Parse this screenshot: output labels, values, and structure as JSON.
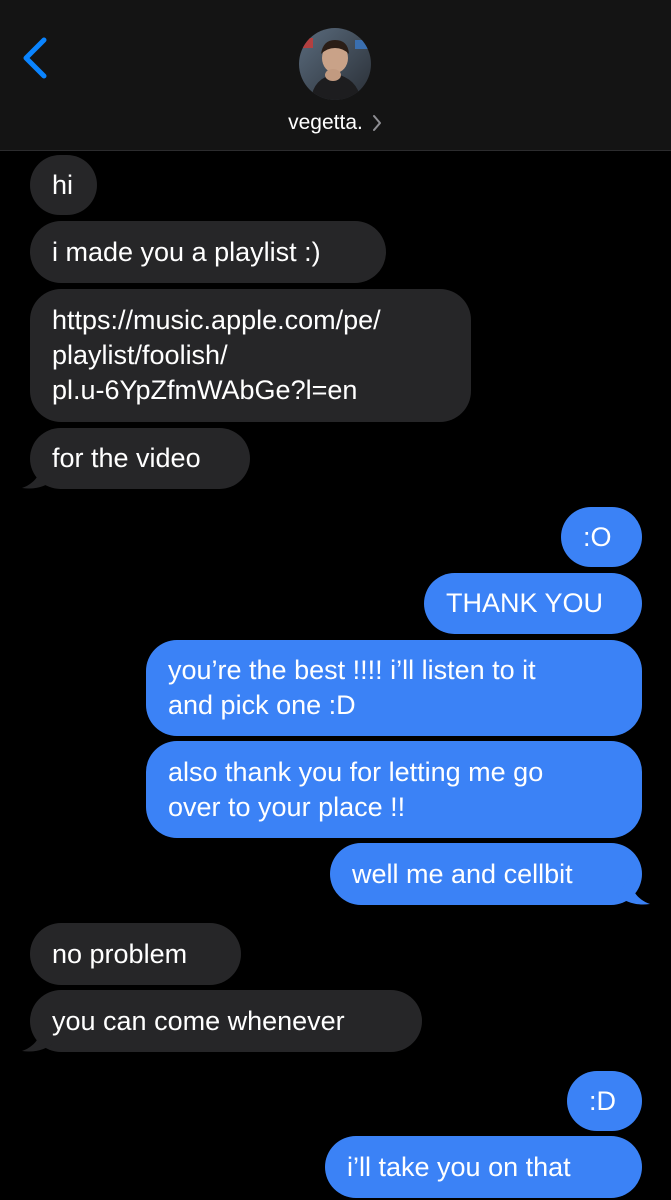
{
  "header": {
    "contact_name": "vegetta.",
    "avatar": "contact-photo"
  },
  "colors": {
    "incoming_bubble": "#262628",
    "outgoing_bubble": "#3b82f6",
    "accent": "#0a84ff",
    "background": "#000000"
  },
  "messages": [
    {
      "from": "them",
      "lines": [
        "hi"
      ]
    },
    {
      "from": "them",
      "lines": [
        "i made you a playlist :)"
      ]
    },
    {
      "from": "them",
      "lines": [
        "https://music.apple.com/pe/",
        "playlist/foolish/",
        "pl.u-6YpZfmWAbGe?l=en"
      ]
    },
    {
      "from": "them",
      "lines": [
        "for the video"
      ]
    },
    {
      "from": "me",
      "lines": [
        ":O"
      ]
    },
    {
      "from": "me",
      "lines": [
        "THANK YOU"
      ]
    },
    {
      "from": "me",
      "lines": [
        "you’re the best !!!! i’ll listen to it",
        "and pick one :D"
      ]
    },
    {
      "from": "me",
      "lines": [
        "also thank you for letting me go",
        "over to your place !!"
      ]
    },
    {
      "from": "me",
      "lines": [
        "well me and cellbit"
      ]
    },
    {
      "from": "them",
      "lines": [
        "no problem"
      ]
    },
    {
      "from": "them",
      "lines": [
        "you can come whenever"
      ]
    },
    {
      "from": "me",
      "lines": [
        ":D"
      ]
    },
    {
      "from": "me",
      "lines": [
        "i’ll take you on that"
      ]
    }
  ]
}
